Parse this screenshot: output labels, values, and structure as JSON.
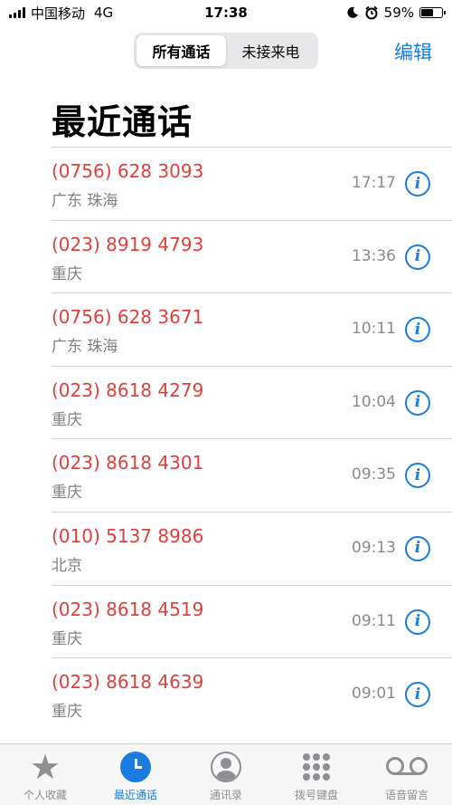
{
  "status_bar": {
    "carrier": "中国移动",
    "network": "4G",
    "time": "17:38",
    "battery": "59%",
    "battery_level": 0.59,
    "icons": [
      "signal-icon",
      "moon-icon",
      "alarm-icon",
      "battery-icon"
    ]
  },
  "nav": {
    "segments": [
      "所有通话",
      "未接来电"
    ],
    "active_segment": 0,
    "edit_label": "编辑"
  },
  "page_title": "最近通话",
  "calls": [
    {
      "number": "(0756) 628 3093",
      "location": "广东 珠海",
      "time": "17:17"
    },
    {
      "number": "(023) 8919 4793",
      "location": "重庆",
      "time": "13:36"
    },
    {
      "number": "(0756) 628 3671",
      "location": "广东 珠海",
      "time": "10:11"
    },
    {
      "number": "(023) 8618 4279",
      "location": "重庆",
      "time": "10:04"
    },
    {
      "number": "(023) 8618 4301",
      "location": "重庆",
      "time": "09:35"
    },
    {
      "number": "(010) 5137 8986",
      "location": "北京",
      "time": "09:13"
    },
    {
      "number": "(023) 8618 4519",
      "location": "重庆",
      "time": "09:11"
    },
    {
      "number": "(023) 8618 4639",
      "location": "重庆",
      "time": "09:01"
    }
  ],
  "info_glyph": "i",
  "tab_bar": [
    {
      "label": "个人收藏",
      "icon": "star-icon"
    },
    {
      "label": "最近通话",
      "icon": "clock-icon"
    },
    {
      "label": "通讯录",
      "icon": "contacts-icon"
    },
    {
      "label": "拨号键盘",
      "icon": "keypad-icon"
    },
    {
      "label": "语音留言",
      "icon": "voicemail-icon"
    }
  ],
  "active_tab": 1,
  "colors": {
    "accent": "#1a7ce0",
    "missed": "#e0403b",
    "secondary_text": "#7f7f84"
  }
}
